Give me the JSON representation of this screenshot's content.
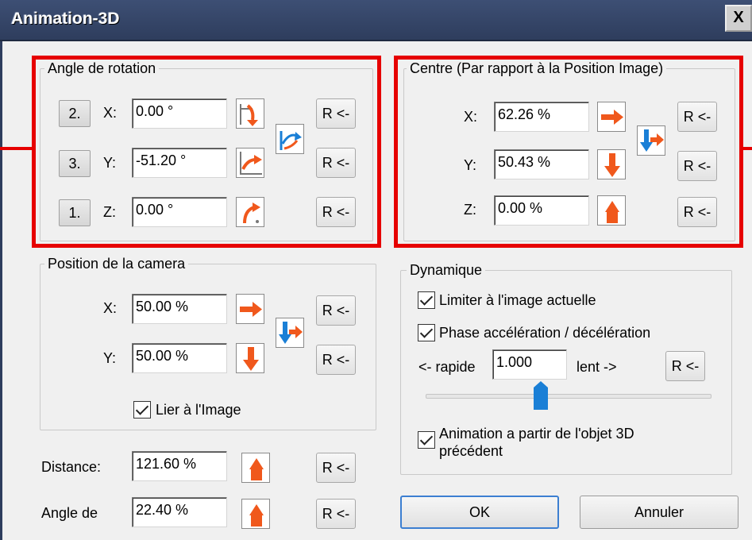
{
  "window": {
    "title": "Animation-3D",
    "close": "X"
  },
  "rotation": {
    "title": "Angle de rotation",
    "rows": [
      {
        "order": "2.",
        "axis": "X:",
        "value": "0.00 °",
        "reset": "R <-"
      },
      {
        "order": "3.",
        "axis": "Y:",
        "value": "-51.20 °",
        "reset": "R <-"
      },
      {
        "order": "1.",
        "axis": "Z:",
        "value": "0.00 °",
        "reset": "R <-"
      }
    ]
  },
  "centre": {
    "title": "Centre (Par rapport à la Position Image)",
    "rows": [
      {
        "axis": "X:",
        "value": "62.26 %",
        "reset": "R <-"
      },
      {
        "axis": "Y:",
        "value": "50.43 %",
        "reset": "R <-"
      },
      {
        "axis": "Z:",
        "value": "0.00 %",
        "reset": "R <-"
      }
    ]
  },
  "camera": {
    "title": "Position de la camera",
    "rows": [
      {
        "axis": "X:",
        "value": "50.00 %",
        "reset": "R <-"
      },
      {
        "axis": "Y:",
        "value": "50.00 %",
        "reset": "R <-"
      }
    ],
    "link_label": "Lier à l'Image"
  },
  "dynamique": {
    "title": "Dynamique",
    "limit_label": "Limiter à l'image actuelle",
    "phase_label": "Phase accélération / décélération",
    "speed_left": "<- rapide",
    "speed_value": "1.000",
    "speed_right": "lent ->",
    "speed_reset": "R <-",
    "from_previous_line1": "Animation a partir de l'objet 3D",
    "from_previous_line2": "précédent"
  },
  "distance": {
    "label": "Distance:",
    "value": "121.60 %",
    "reset": "R <-"
  },
  "angle": {
    "label": "Angle de",
    "value": "22.40 %",
    "reset": "R <-"
  },
  "buttons": {
    "ok": "OK",
    "cancel": "Annuler"
  },
  "colors": {
    "accent_orange": "#f0581c",
    "accent_blue": "#1a7fd6",
    "highlight_red": "#e60000"
  }
}
